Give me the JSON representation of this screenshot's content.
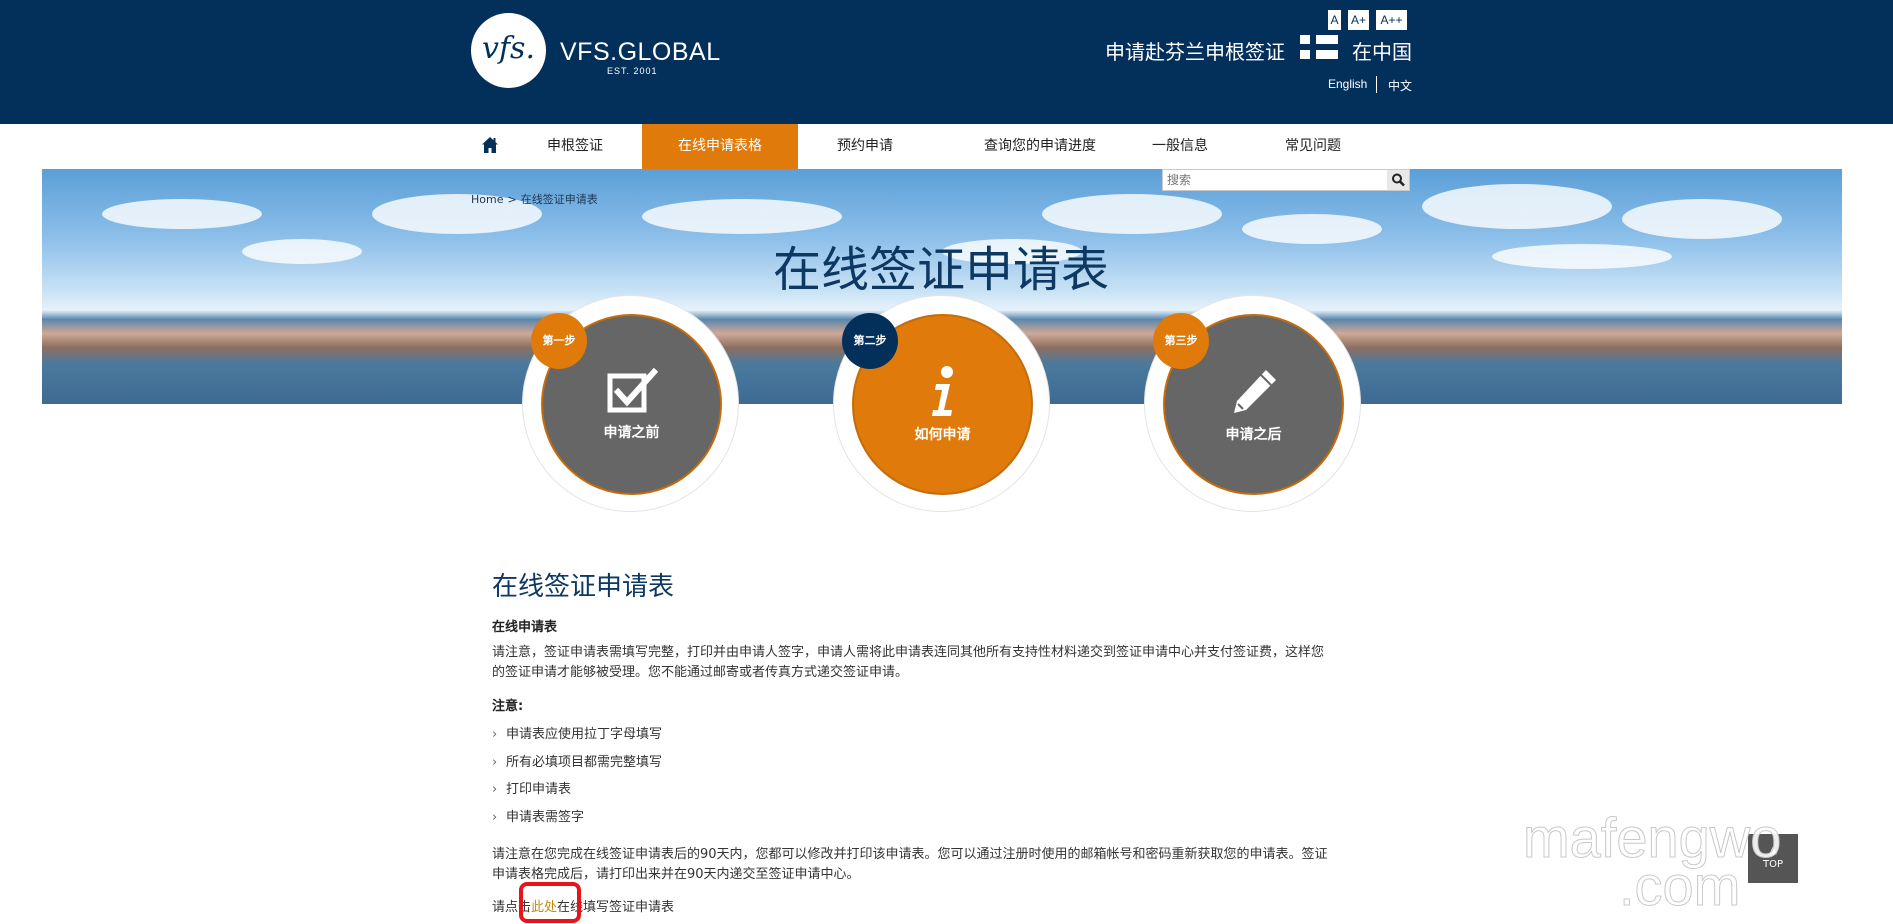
{
  "header": {
    "logo_mark": "vfs.",
    "logo_text": "VFS.GLOBAL",
    "logo_est": "EST. 2001",
    "font_sizes": [
      "A",
      "A+",
      "A++"
    ],
    "title": "申请赴芬兰申根签证",
    "country": "在中国",
    "languages": [
      "English",
      "中文"
    ],
    "colors": {
      "navy": "#03305a",
      "orange": "#df7a0b"
    }
  },
  "nav": {
    "home_icon": "home-icon",
    "items": [
      "申根签证",
      "在线申请表格",
      "预约申请",
      "查询您的申请进度",
      "一般信息",
      "常见问题"
    ],
    "active_index": 1
  },
  "search": {
    "placeholder": "搜索",
    "icon": "search-icon"
  },
  "breadcrumb": {
    "home": "Home",
    "separator": ">",
    "current": "在线签证申请表"
  },
  "banner": {
    "title": "在线签证申请表"
  },
  "steps": [
    {
      "badge": "第一步",
      "label": "申请之前",
      "icon": "checkbox-icon"
    },
    {
      "badge": "第二步",
      "label": "如何申请",
      "icon": "info-icon"
    },
    {
      "badge": "第三步",
      "label": "申请之后",
      "icon": "pencil-icon"
    }
  ],
  "content": {
    "title": "在线签证申请表",
    "subtitle": "在线申请表",
    "para1_line1": "请注意，签证申请表需填写完整，打印并由申请人签字，申请人需将此申请表连同其他所有支持性材料递交到签证申请中心并支付签证费，这样您",
    "para1_line2": "的签证申请才能够被受理。您不能通过邮寄或者传真方式递交签证申请。",
    "note_title": "注意:",
    "notes": [
      "申请表应使用拉丁字母填写",
      "所有必填项目都需完整填写",
      "打印申请表",
      "申请表需签字"
    ],
    "para2_line1": "请注意在您完成在线签证申请表后的90天内，您都可以修改并打印该申请表。您可以通过注册时使用的邮箱帐号和密码重新获取您的申请表。签证",
    "para2_line2": "申请表格完成后，请打印出来并在90天内递交至签证申请中心。",
    "last_prefix": "请点击",
    "last_link": "此处",
    "last_suffix": "在线填写签证申请表"
  },
  "to_top": "TOP",
  "watermark": {
    "line1": "mafengwo",
    "line2": ".com"
  }
}
